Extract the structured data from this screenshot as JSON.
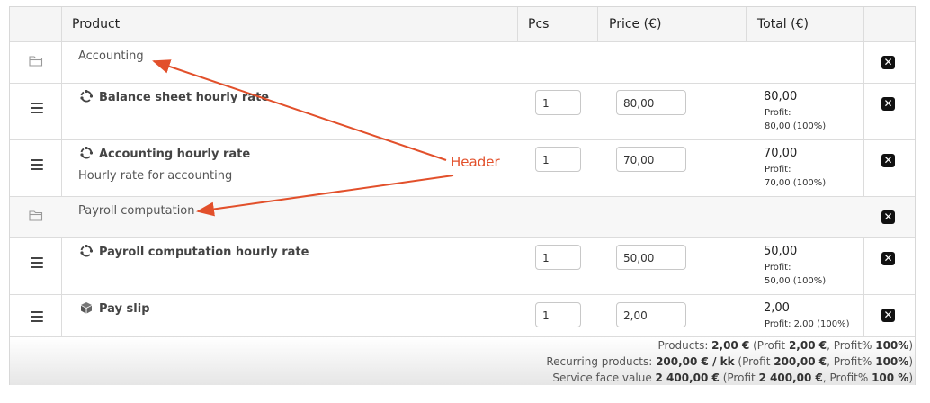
{
  "columns": {
    "product": "Product",
    "pcs": "Pcs",
    "price": "Price (€)",
    "total": "Total (€)"
  },
  "groups": [
    {
      "name": "Accounting"
    },
    {
      "name": "Payroll computation"
    }
  ],
  "items": [
    {
      "name": "Balance sheet hourly rate",
      "description": "",
      "pcs": "1",
      "price": "80,00",
      "total": "80,00",
      "profit_label": "Profit:",
      "profit_value": "80,00 (100%)",
      "icon": "recurring-icon"
    },
    {
      "name": "Accounting hourly rate",
      "description": "Hourly rate for accounting",
      "pcs": "1",
      "price": "70,00",
      "total": "70,00",
      "profit_label": "Profit:",
      "profit_value": "70,00 (100%)",
      "icon": "recurring-icon"
    },
    {
      "name": "Payroll computation hourly rate",
      "description": "",
      "pcs": "1",
      "price": "50,00",
      "total": "50,00",
      "profit_label": "Profit:",
      "profit_value": "50,00 (100%)",
      "icon": "recurring-icon"
    },
    {
      "name": "Pay slip",
      "description": "",
      "pcs": "1",
      "price": "2,00",
      "total": "2,00",
      "profit_label": "Profit: 2,00 (100%)",
      "profit_value": "",
      "icon": "box-icon"
    }
  ],
  "summary": {
    "products": {
      "label": "Products: ",
      "amount": "2,00 €",
      "mid": " (Profit ",
      "profit": "2,00 €",
      "sep": ", Profit% ",
      "pct": "100%",
      "close": ")"
    },
    "recurring": {
      "label": "Recurring products: ",
      "amount": "200,00 € / kk",
      "mid": " (Profit ",
      "profit": "200,00 €",
      "sep": ", Profit% ",
      "pct": "100%",
      "close": ")"
    },
    "service": {
      "label": "Service face value ",
      "amount": "2 400,00 €",
      "mid": " (Profit ",
      "profit": "2 400,00 €",
      "sep": ", Profit% ",
      "pct": "100 %",
      "close": ")"
    }
  },
  "annotation": {
    "text": "Header",
    "color": "#e2502b"
  },
  "icons": {
    "group": "folder-icon",
    "drag": "drag-handle-icon",
    "delete": "delete-icon"
  }
}
